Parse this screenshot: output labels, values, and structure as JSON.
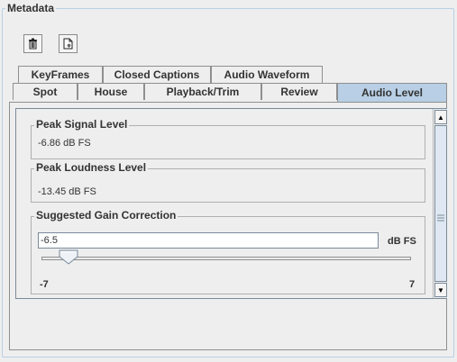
{
  "metadata": {
    "title": "Metadata"
  },
  "toolbar": {
    "delete_icon": "trash-icon",
    "new_icon": "new-document-icon"
  },
  "tabs_row1": [
    {
      "label": "KeyFrames"
    },
    {
      "label": "Closed Captions"
    },
    {
      "label": "Audio Waveform"
    }
  ],
  "tabs_row2": [
    {
      "label": "Spot"
    },
    {
      "label": "House"
    },
    {
      "label": "Playback/Trim"
    },
    {
      "label": "Review"
    },
    {
      "label": "Audio Level",
      "selected": true
    }
  ],
  "peak_signal": {
    "title": "Peak Signal Level",
    "value": "-6.86 dB FS"
  },
  "peak_loudness": {
    "title": "Peak Loudness Level",
    "value": "-13.45 dB FS"
  },
  "gain": {
    "title": "Suggested Gain Correction",
    "value": "-6.5",
    "unit": "dB FS",
    "min_label": "-7",
    "max_label": "7",
    "slider_fraction": 0.036
  },
  "colors": {
    "selected_tab": "#b8cfe5",
    "border": "#8e8f8f"
  }
}
